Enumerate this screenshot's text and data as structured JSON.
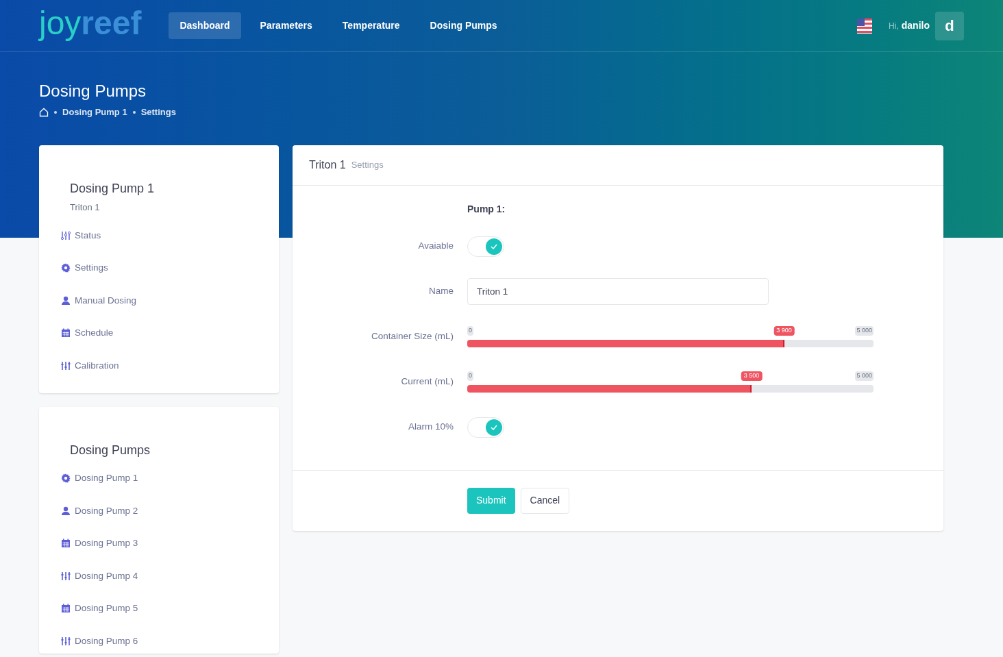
{
  "logo": {
    "light_part": "joy",
    "bold_part": "reef"
  },
  "nav": [
    {
      "label": "Dashboard",
      "selected": true
    },
    {
      "label": "Parameters",
      "selected": false
    },
    {
      "label": "Temperature",
      "selected": false
    },
    {
      "label": "Dosing Pumps",
      "selected": false
    }
  ],
  "user": {
    "greeting": "Hi,",
    "name": "danilo",
    "avatar": "d"
  },
  "page_title": "Dosing Pumps",
  "breadcrumb": [
    "Dosing Pump 1",
    "Settings"
  ],
  "pump_card": {
    "title": "Dosing Pump 1",
    "subtitle": "Triton 1",
    "items": [
      {
        "kind": "sliders",
        "label": "Status"
      },
      {
        "kind": "gear",
        "label": "Settings"
      },
      {
        "kind": "person",
        "label": "Manual Dosing"
      },
      {
        "kind": "calendar",
        "label": "Schedule"
      },
      {
        "kind": "tune",
        "label": "Calibration"
      }
    ]
  },
  "pumps_card": {
    "title": "Dosing Pumps",
    "items": [
      {
        "kind": "gear",
        "label": "Dosing Pump 1"
      },
      {
        "kind": "person",
        "label": "Dosing Pump 2"
      },
      {
        "kind": "calendar",
        "label": "Dosing Pump 3"
      },
      {
        "kind": "tune",
        "label": "Dosing Pump 4"
      },
      {
        "kind": "calendar",
        "label": "Dosing Pump 5"
      },
      {
        "kind": "tune",
        "label": "Dosing Pump 6"
      }
    ]
  },
  "form": {
    "title": "Triton 1",
    "subtitle": "Settings",
    "section": "Pump 1:",
    "fields": [
      {
        "kind": "toggle",
        "label": "Avaiable",
        "on": true
      },
      {
        "kind": "text",
        "label": "Name",
        "value": "Triton 1"
      },
      {
        "kind": "slider",
        "label": "Container Size (mL)",
        "min": "0",
        "max": "5 000",
        "reading": "3 900",
        "level": 0.78
      },
      {
        "kind": "slider",
        "label": "Current (mL)",
        "min": "0",
        "max": "5 000",
        "reading": "3 500",
        "level": 0.7
      },
      {
        "kind": "toggle",
        "label": "Alarm 10%",
        "on": true
      }
    ],
    "buttons": {
      "submit": "Submit",
      "cancel": "Cancel"
    }
  }
}
